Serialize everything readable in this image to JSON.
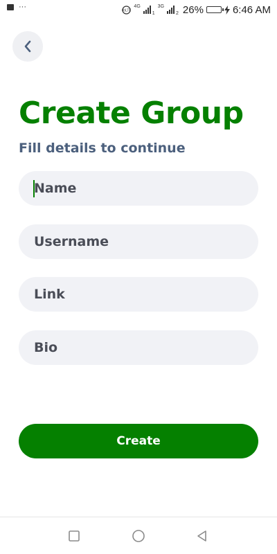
{
  "status_bar": {
    "overflow_dots": "···",
    "net_4g": "4G",
    "net_3g": "3G",
    "sim1": "1",
    "sim2": "2",
    "battery_percent": "26%",
    "battery_level": 0.26,
    "time": "6:46 AM"
  },
  "header": {
    "back_icon": "chevron-left-icon"
  },
  "title": "Create Group",
  "subtitle": "Fill details to continue",
  "form": {
    "name_placeholder": "Name",
    "username_placeholder": "Username",
    "link_placeholder": "Link",
    "bio_placeholder": "Bio",
    "submit_label": "Create"
  },
  "nav_bar": {
    "recents_icon": "square-icon",
    "home_icon": "circle-icon",
    "back_icon": "triangle-back-icon"
  },
  "colors": {
    "accent": "#058000",
    "subtitle": "#4c607d",
    "field_bg": "#f1f2f6",
    "text": "#4a4d57"
  }
}
